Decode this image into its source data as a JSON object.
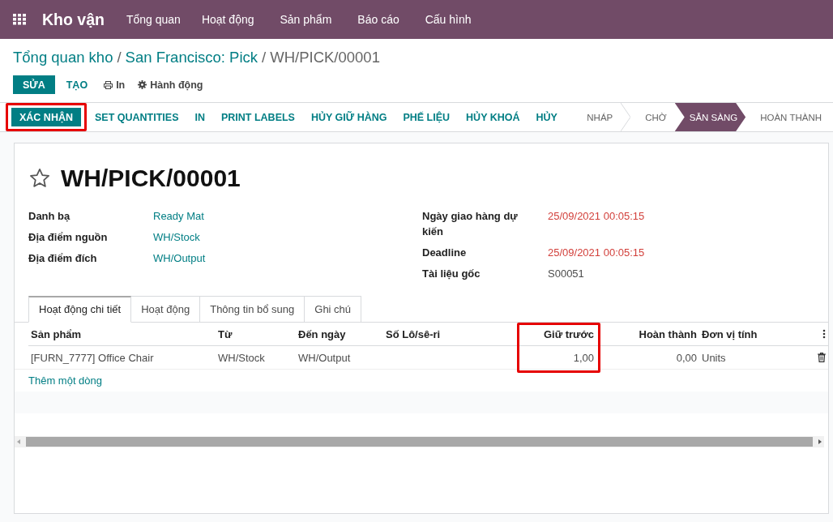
{
  "app": {
    "title": "Kho vận",
    "menu": [
      "Tổng quan",
      "Hoạt động",
      "Sản phẩm",
      "Báo cáo",
      "Cấu hình"
    ]
  },
  "breadcrumb": {
    "separator": "/",
    "items": [
      {
        "label": "Tổng quan kho",
        "kind": "link"
      },
      {
        "label": "San Francisco: Pick",
        "kind": "link"
      },
      {
        "label": "WH/PICK/00001",
        "kind": "current"
      }
    ]
  },
  "toolbar": [
    {
      "label": "SỬA",
      "kind": "primary"
    },
    {
      "label": "TẠO",
      "kind": "secondary"
    },
    {
      "label": "In",
      "kind": "print"
    },
    {
      "label": "Hành động",
      "kind": "action"
    }
  ],
  "actions": [
    {
      "label": "XÁC NHẬN",
      "kind": "primary",
      "highlighted": true
    },
    {
      "label": "SET QUANTITIES",
      "kind": "secondary",
      "highlighted": false
    },
    {
      "label": "IN",
      "kind": "secondary",
      "highlighted": false
    },
    {
      "label": "PRINT LABELS",
      "kind": "secondary",
      "highlighted": false
    },
    {
      "label": "HỦY GIỮ HÀNG",
      "kind": "secondary",
      "highlighted": false
    },
    {
      "label": "PHẾ LIỆU",
      "kind": "secondary",
      "highlighted": false
    },
    {
      "label": "HỦY KHOÁ",
      "kind": "secondary",
      "highlighted": false
    },
    {
      "label": "HỦY",
      "kind": "secondary",
      "highlighted": false
    }
  ],
  "stages": [
    {
      "label": "NHÁP",
      "selected": false
    },
    {
      "label": "CHỜ",
      "selected": false
    },
    {
      "label": "SẴN SÀNG",
      "selected": true
    },
    {
      "label": "HOÀN THÀNH",
      "selected": false
    }
  ],
  "record": {
    "starred": false,
    "title": "WH/PICK/00001"
  },
  "fields_left": [
    {
      "label": "Danh bạ",
      "value": "Ready Mat",
      "kind": "link"
    },
    {
      "label": "Địa điểm nguồn",
      "value": "WH/Stock",
      "kind": "link"
    },
    {
      "label": "Địa điểm đích",
      "value": "WH/Output",
      "kind": "link"
    }
  ],
  "fields_right": [
    {
      "label": "Ngày giao hàng dự kiến",
      "value": "25/09/2021 00:05:15",
      "kind": "overdue"
    },
    {
      "label": "Deadline",
      "value": "25/09/2021 00:05:15",
      "kind": "overdue"
    },
    {
      "label": "Tài liệu gốc",
      "value": "S00051",
      "kind": "plain"
    }
  ],
  "tabs": [
    {
      "label": "Hoạt động chi tiết",
      "selected": true
    },
    {
      "label": "Hoạt động",
      "selected": false
    },
    {
      "label": "Thông tin bổ sung",
      "selected": false
    },
    {
      "label": "Ghi chú",
      "selected": false
    }
  ],
  "table": {
    "columns": [
      {
        "label": "Sản phẩm",
        "kind": "text",
        "highlighted": false
      },
      {
        "label": "Từ",
        "kind": "text",
        "highlighted": false
      },
      {
        "label": "Đến ngày",
        "kind": "text",
        "highlighted": false
      },
      {
        "label": "Số Lô/sê-ri",
        "kind": "text",
        "highlighted": false
      },
      {
        "label": "Giữ trước",
        "kind": "number",
        "highlighted": true
      },
      {
        "label": "Hoàn thành",
        "kind": "number",
        "highlighted": false
      },
      {
        "label": "Đơn vị tính",
        "kind": "text",
        "highlighted": false
      }
    ],
    "rows": [
      {
        "cells": [
          "[FURN_7777] Office Chair",
          "WH/Stock",
          "WH/Output",
          null,
          "1,00",
          "0,00",
          "Units"
        ]
      }
    ],
    "add_line": "Thêm một dòng"
  }
}
